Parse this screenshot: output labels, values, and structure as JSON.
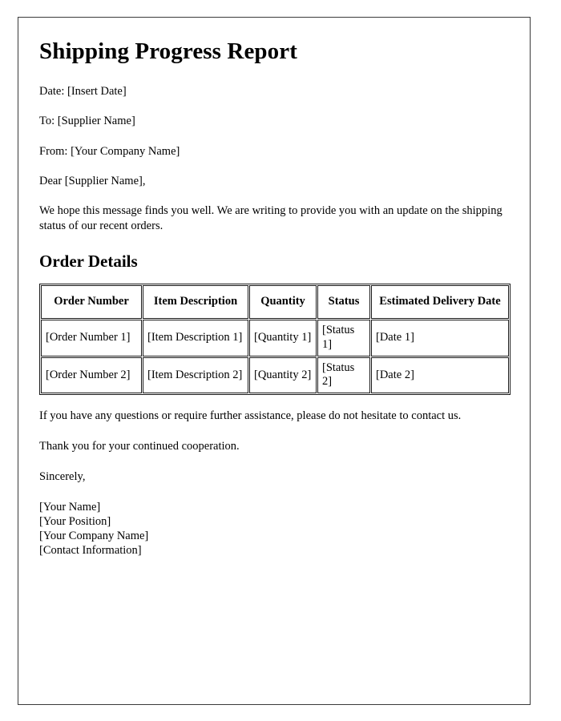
{
  "document": {
    "title": "Shipping Progress Report",
    "meta_lines": [
      "Date: [Insert Date]",
      "To: [Supplier Name]",
      "From: [Your Company Name]"
    ],
    "salutation": "Dear [Supplier Name],",
    "intro_paragraph": "We hope this message finds you well. We are writing to provide you with an update on the shipping status of our recent orders.",
    "section_heading": "Order Details",
    "table": {
      "headers": [
        "Order Number",
        "Item Description",
        "Quantity",
        "Status",
        "Estimated Delivery Date"
      ],
      "rows": [
        {
          "order_number": "[Order Number 1]",
          "item_description": "[Item Description 1]",
          "quantity": "[Quantity 1]",
          "status": "[Status 1]",
          "estimated_delivery_date": "[Date 1]"
        },
        {
          "order_number": "[Order Number 2]",
          "item_description": "[Item Description 2]",
          "quantity": "[Quantity 2]",
          "status": "[Status 2]",
          "estimated_delivery_date": "[Date 2]"
        }
      ]
    },
    "closing_paragraph": "If you have any questions or require further assistance, please do not hesitate to contact us.",
    "thanks_paragraph": "Thank you for your continued cooperation.",
    "sign_off": "Sincerely,",
    "signature_lines": [
      "[Your Name]",
      "[Your Position]",
      "[Your Company Name]",
      "[Contact Information]"
    ]
  },
  "colors": {
    "text": "#000000",
    "page_background": "#ffffff",
    "page_border": "#3a3a3a",
    "table_border": "#1a1a1a"
  }
}
